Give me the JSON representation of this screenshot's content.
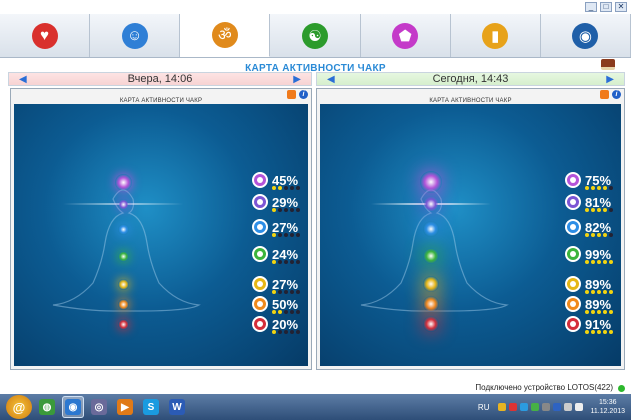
{
  "window": {
    "minimize": "_",
    "maximize": "□",
    "close": "✕"
  },
  "tabs": [
    {
      "icon": "heart-icon",
      "symbol": "♥",
      "color": "#d9302d"
    },
    {
      "icon": "head-profile-icon",
      "symbol": "☺",
      "color": "#2f7fd6"
    },
    {
      "icon": "om-icon",
      "symbol": "ॐ",
      "color": "#e08a1c"
    },
    {
      "icon": "yin-yang-icon",
      "symbol": "☯",
      "color": "#2c9b2c"
    },
    {
      "icon": "pentagon-icon",
      "symbol": "⬟",
      "color": "#c43ac9"
    },
    {
      "icon": "bar-chart-icon",
      "symbol": "▮",
      "color": "#e7a21a"
    },
    {
      "icon": "globe-icon",
      "symbol": "◉",
      "color": "#1f5fa8"
    }
  ],
  "page_title": "КАРТА АКТИВНОСТИ ЧАКР",
  "days": {
    "left": {
      "label": "Вчера, 14:06"
    },
    "right": {
      "label": "Сегодня, 14:43"
    }
  },
  "panels": {
    "left": {
      "title": "КАРТА АКТИВНОСТИ ЧАКР",
      "chakras": [
        {
          "name": "crown",
          "percent": "45%",
          "stars": 2,
          "color": "#b454d9"
        },
        {
          "name": "third-eye",
          "percent": "29%",
          "stars": 1,
          "color": "#7c55d4"
        },
        {
          "name": "throat",
          "percent": "27%",
          "stars": 1,
          "color": "#2d8ee6"
        },
        {
          "name": "heart",
          "percent": "24%",
          "stars": 1,
          "color": "#3cb43c"
        },
        {
          "name": "solar-plexus",
          "percent": "27%",
          "stars": 1,
          "color": "#e5b716"
        },
        {
          "name": "sacral",
          "percent": "50%",
          "stars": 2,
          "color": "#f08a1c"
        },
        {
          "name": "root",
          "percent": "20%",
          "stars": 1,
          "color": "#d42e3a"
        }
      ]
    },
    "right": {
      "title": "КАРТА АКТИВНОСТИ ЧАКР",
      "chakras": [
        {
          "name": "crown",
          "percent": "75%",
          "stars": 4,
          "color": "#b454d9"
        },
        {
          "name": "third-eye",
          "percent": "81%",
          "stars": 4,
          "color": "#7c55d4"
        },
        {
          "name": "throat",
          "percent": "82%",
          "stars": 4,
          "color": "#2d8ee6"
        },
        {
          "name": "heart",
          "percent": "99%",
          "stars": 5,
          "color": "#3cb43c"
        },
        {
          "name": "solar-plexus",
          "percent": "89%",
          "stars": 5,
          "color": "#e5b716"
        },
        {
          "name": "sacral",
          "percent": "89%",
          "stars": 5,
          "color": "#f08a1c"
        },
        {
          "name": "root",
          "percent": "91%",
          "stars": 5,
          "color": "#d42e3a"
        }
      ]
    }
  },
  "status": {
    "text": "Подключено устройство LOTOS(422)"
  },
  "taskbar": {
    "apps": [
      {
        "icon": "chrome-icon",
        "symbol": "◍",
        "color": "#3a9a3a",
        "active": false
      },
      {
        "icon": "globe-app-icon",
        "symbol": "◉",
        "color": "#2c78d0",
        "active": true
      },
      {
        "icon": "eye-app-icon",
        "symbol": "◎",
        "color": "#6a6a9a",
        "active": false
      },
      {
        "icon": "media-player-icon",
        "symbol": "▶",
        "color": "#e07a18",
        "active": false
      },
      {
        "icon": "skype-icon",
        "symbol": "S",
        "color": "#1a9be0",
        "active": false
      },
      {
        "icon": "word-icon",
        "symbol": "W",
        "color": "#2b5bb5",
        "active": false
      }
    ],
    "language": "RU",
    "time": "15:36",
    "date": "11.12.2013"
  }
}
